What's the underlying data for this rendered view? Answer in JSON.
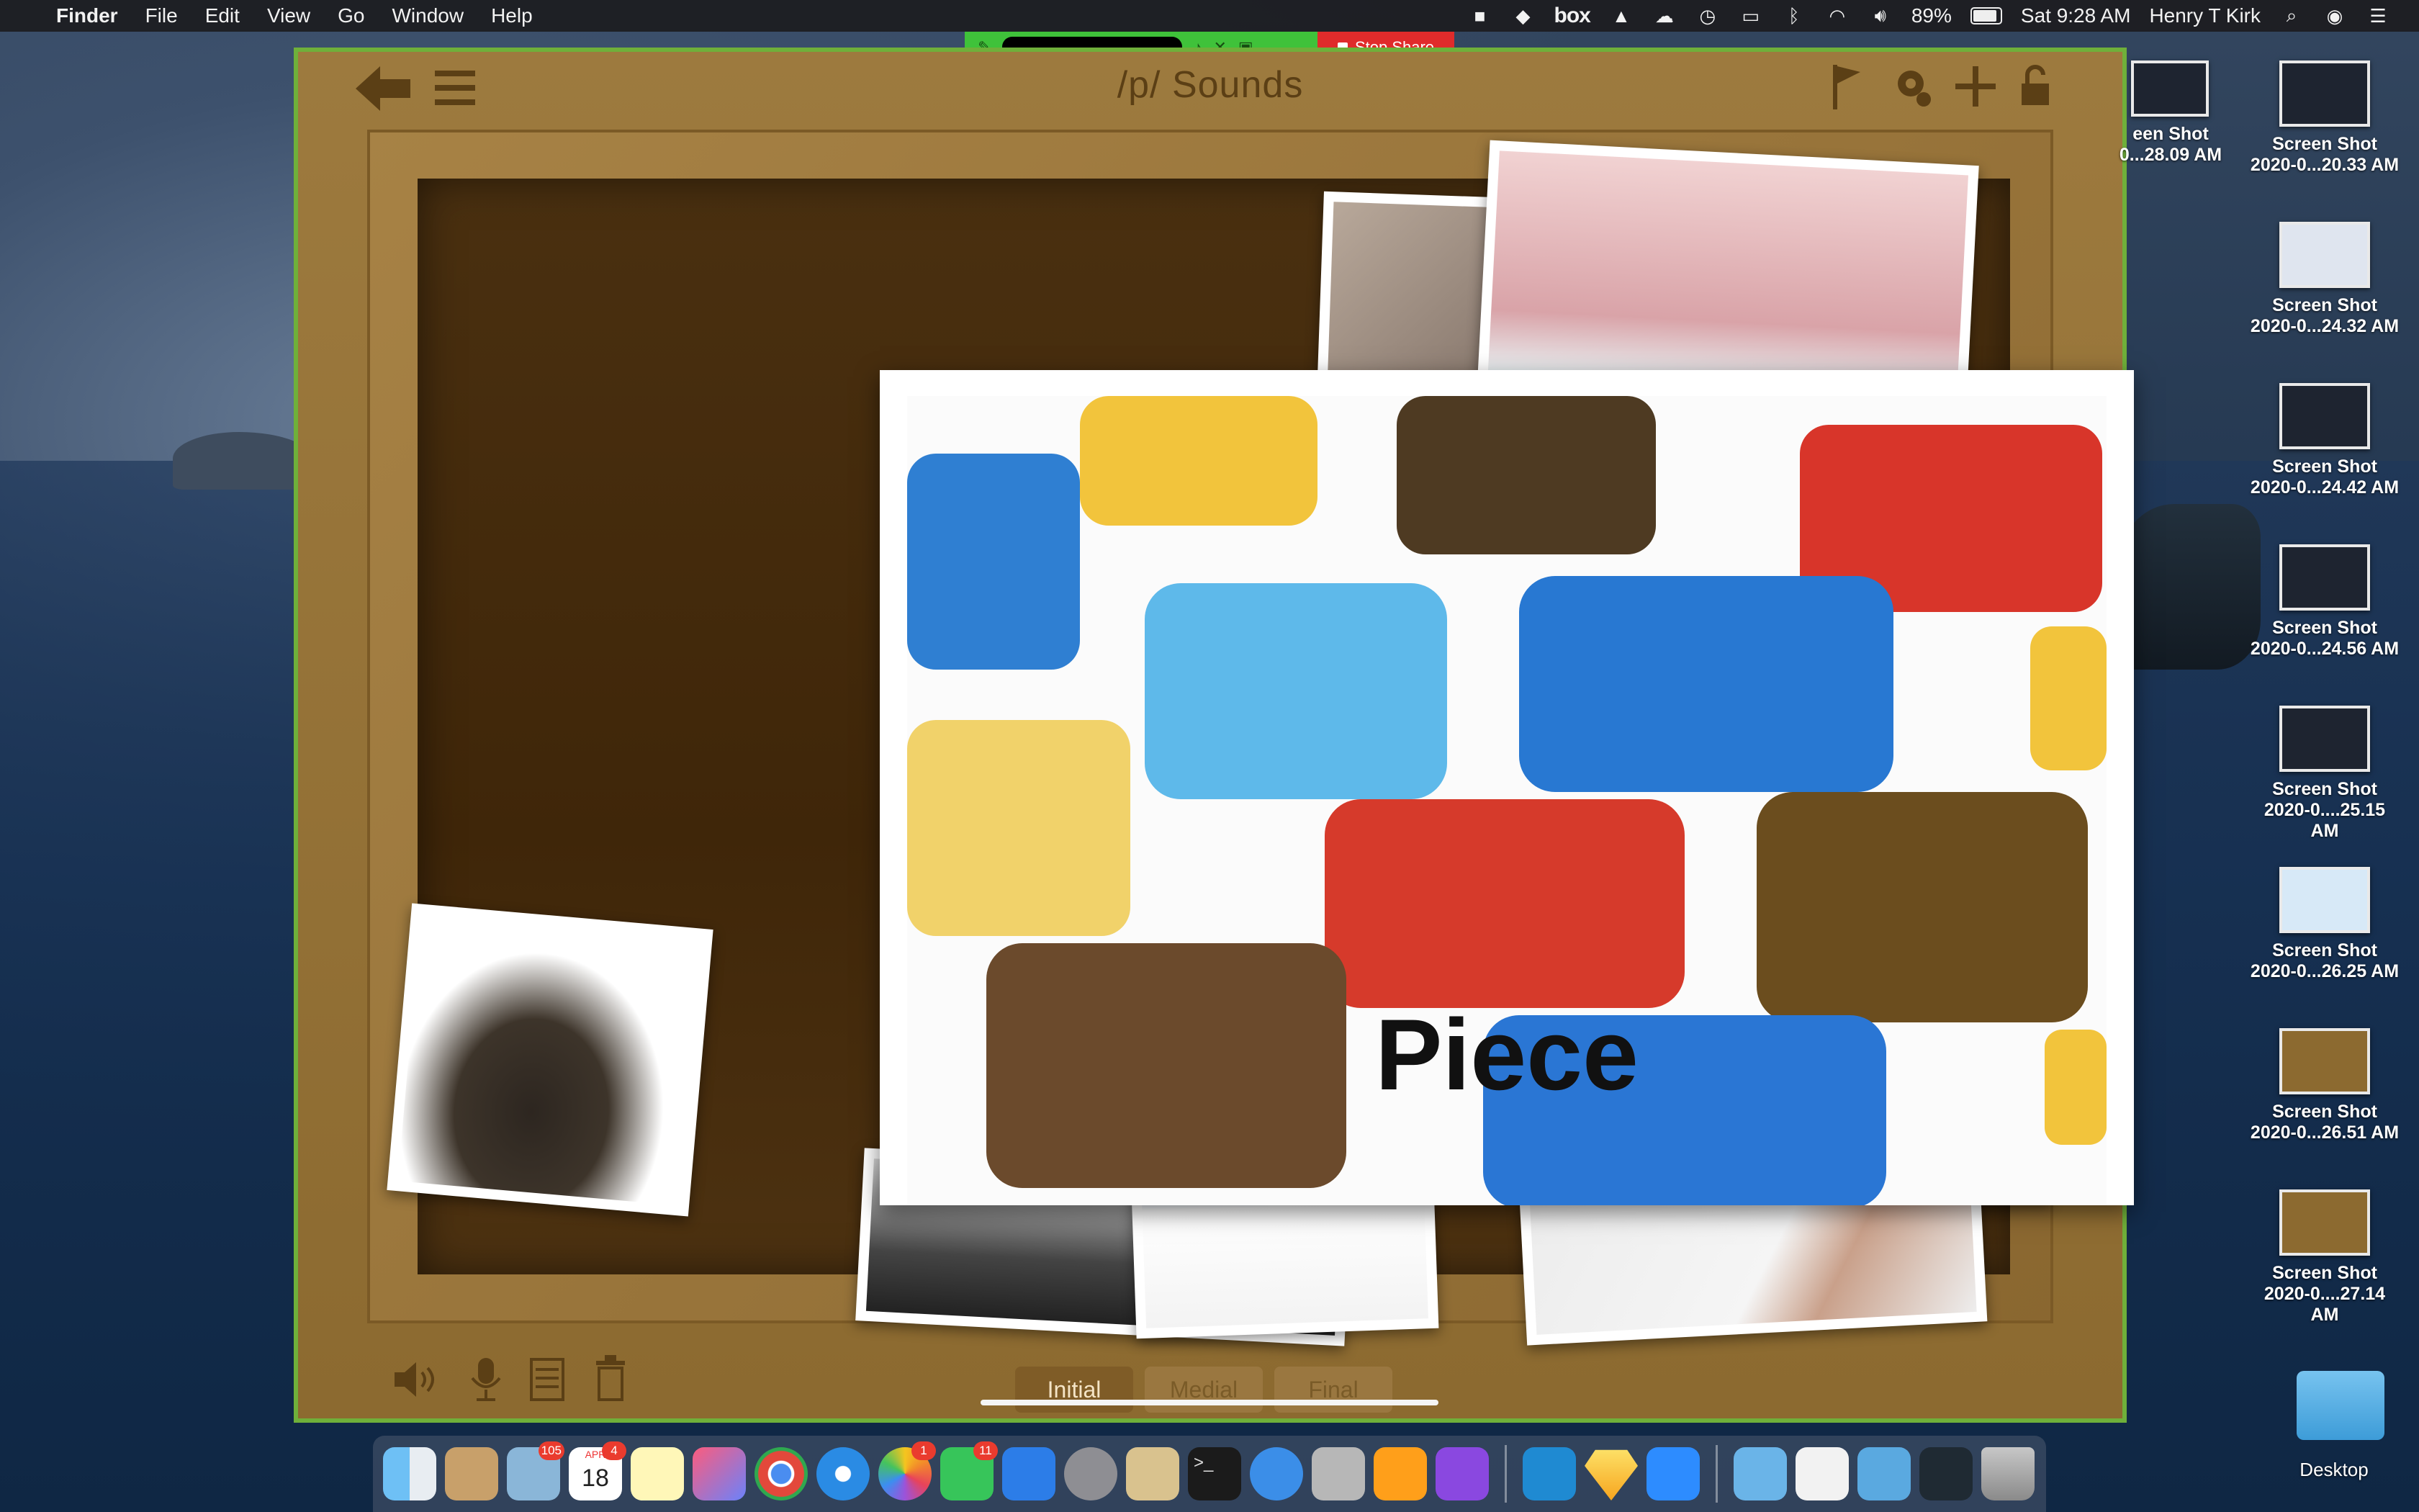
{
  "menubar": {
    "app_name": "Finder",
    "menus": [
      "File",
      "Edit",
      "View",
      "Go",
      "Window",
      "Help"
    ],
    "box_label": "box",
    "battery": "89%",
    "clock": "Sat 9:28 AM",
    "user": "Henry T Kirk"
  },
  "sharebar": {
    "stop_label": "Stop Share"
  },
  "app": {
    "title": "/p/ Sounds",
    "word": "Piece",
    "segments": [
      "Initial",
      "Medial",
      "Final"
    ],
    "active_segment": "Initial",
    "accent_frame": "#6fb03a"
  },
  "desktop": {
    "files": [
      {
        "name": "een Shot",
        "sub": "0...28.09 AM"
      },
      {
        "name": "Screen Shot",
        "sub": "2020-0...20.33 AM"
      },
      {
        "name": "Screen Shot",
        "sub": "2020-0...24.32 AM"
      },
      {
        "name": "Screen Shot",
        "sub": "2020-0...24.42 AM"
      },
      {
        "name": "Screen Shot",
        "sub": "2020-0...24.56 AM"
      },
      {
        "name": "Screen Shot",
        "sub": "2020-0....25.15 AM"
      },
      {
        "name": "Screen Shot",
        "sub": "2020-0...26.25 AM"
      },
      {
        "name": "Screen Shot",
        "sub": "2020-0...26.51 AM"
      },
      {
        "name": "Screen Shot",
        "sub": "2020-0....27.14 AM"
      }
    ],
    "folder_label": "Desktop"
  },
  "dock": {
    "badges": {
      "mail": "105",
      "calendar_day": "18",
      "calendar_month": "APR",
      "calendar_badge": "4",
      "photos": "1",
      "messages": "11"
    }
  }
}
